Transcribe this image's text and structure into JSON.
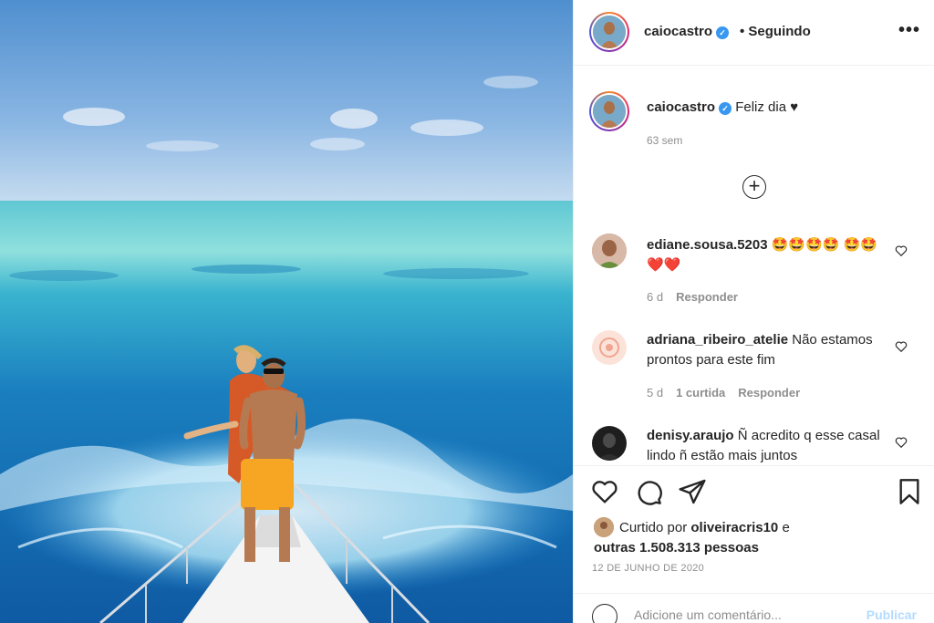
{
  "post": {
    "author": "caiocastro",
    "follow_status": "• Seguindo",
    "more_label": "•••",
    "caption_text": "Feliz dia ♥",
    "caption_time": "63 sem",
    "load_more_label": "+",
    "comments": [
      {
        "username": "ediane.sousa.5203",
        "text": "🤩🤩🤩🤩 🤩🤩❤️❤️",
        "time": "6 d",
        "reply_label": "Responder"
      },
      {
        "username": "adriana_ribeiro_atelie",
        "text": "Não estamos prontos para este fim",
        "time": "5 d",
        "likes": "1 curtida",
        "reply_label": "Responder"
      },
      {
        "username": "denisy.araujo",
        "text": "Ñ acredito q esse casal lindo ñ estão mais juntos"
      }
    ],
    "liked_by_prefix": "Curtido por",
    "liked_by_user": "oliveiracris10",
    "liked_by_conj": "e",
    "liked_by_others": "outras 1.508.313 pessoas",
    "date": "12 DE JUNHO DE 2020",
    "add_comment_placeholder": "Adicione um comentário...",
    "publish_label": "Publicar"
  },
  "colors": {
    "verified": "#3897f0",
    "muted": "#8e8e8e",
    "publish_disabled": "#b3dbff"
  }
}
